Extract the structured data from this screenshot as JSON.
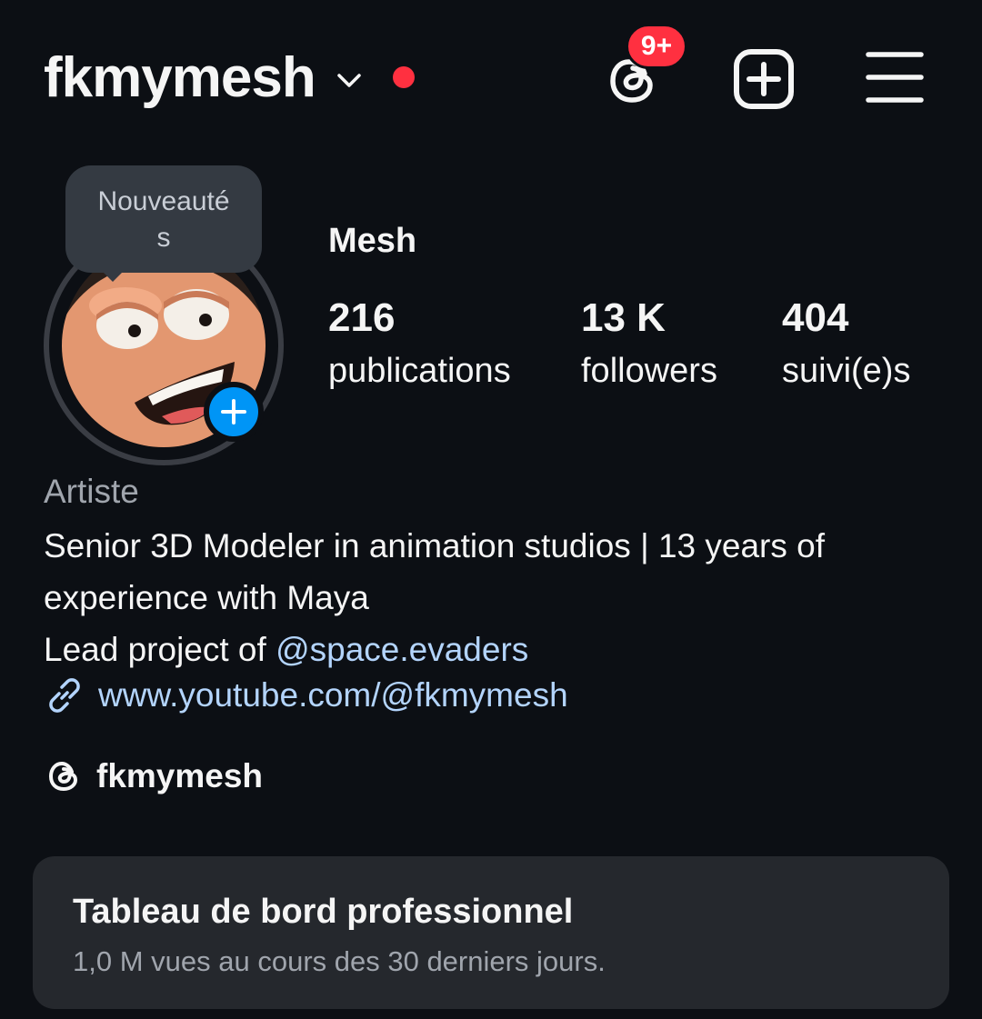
{
  "header": {
    "username": "fkmymesh",
    "threads_badge": "9+",
    "icons": [
      "chevron-down-icon",
      "notification-dot",
      "threads-icon",
      "create-post-icon",
      "menu-icon"
    ],
    "accent_red": "#ff3040"
  },
  "tooltip": {
    "text": "Nouveauté\ns"
  },
  "profile": {
    "display_name": "Mesh",
    "stats": [
      {
        "value": "216",
        "label": "publications"
      },
      {
        "value": "13 K",
        "label": "followers"
      },
      {
        "value": "404",
        "label": "suivi(e)s"
      }
    ],
    "category": "Artiste",
    "bio_line1": "Senior 3D Modeler in animation studios | 13 years of experience with Maya",
    "bio_line2_prefix": "Lead project of ",
    "bio_mention": "@space.evaders",
    "link": "www.youtube.com/@fkmymesh",
    "threads_handle": "fkmymesh"
  },
  "dashboard": {
    "title": "Tableau de bord professionnel",
    "subtitle": "1,0 M vues au cours des 30 derniers jours."
  },
  "colors": {
    "background": "#0c0f14",
    "link": "#b3d4fc",
    "card": "#25282d",
    "story_add": "#0095f6"
  }
}
